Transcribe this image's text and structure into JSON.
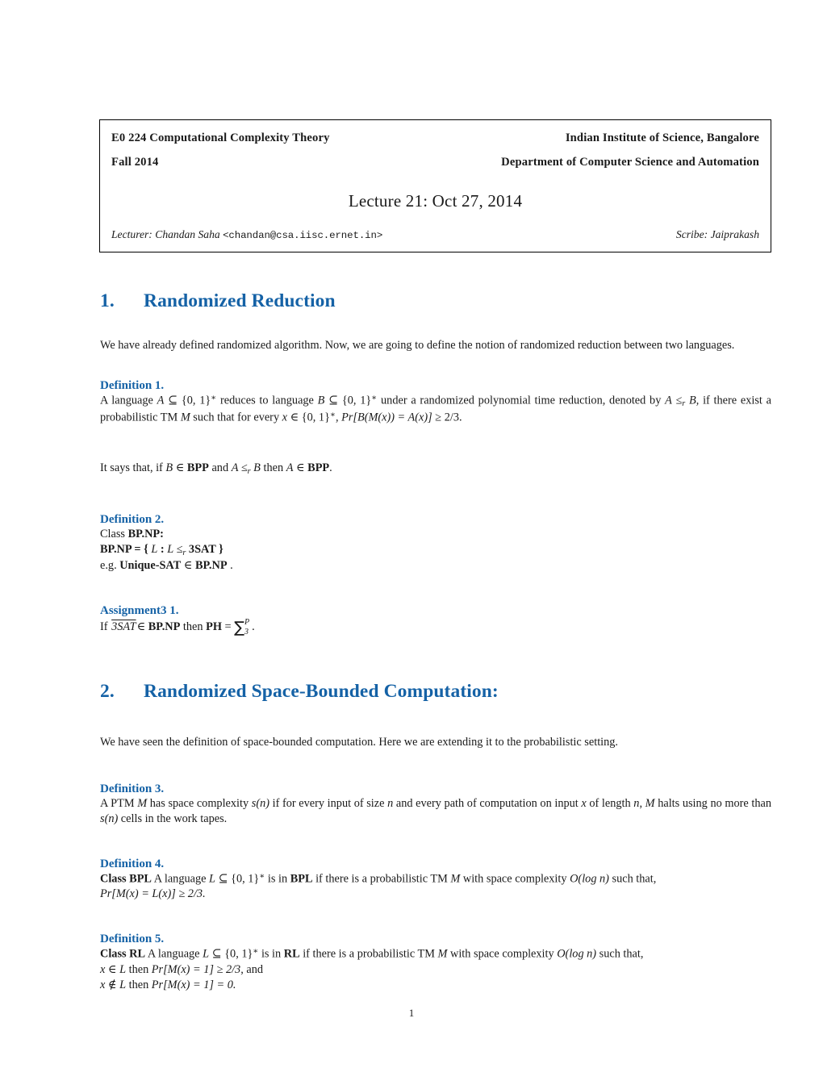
{
  "header": {
    "course": "E0 224 Computational Complexity Theory",
    "institute": "Indian Institute of Science, Bangalore",
    "term": "Fall 2014",
    "department": "Department of Computer Science and Automation",
    "lecture_title": "Lecture 21: Oct 27, 2014",
    "lecturer_label": "Lecturer:",
    "lecturer_name": "Chandan Saha",
    "lecturer_email": "<chandan@csa.iisc.ernet.in>",
    "scribe_label": "Scribe:",
    "scribe_name": "Jaiprakash"
  },
  "sections": {
    "s1": {
      "number": "1.",
      "title": "Randomized Reduction",
      "intro": "We have already defined randomized algorithm. Now, we are going to define the notion of randomized reduction between two languages.",
      "def1": {
        "heading": "Definition 1.",
        "line1_a": "A language ",
        "line1_A": "A",
        "line1_b": " ⊆ {0, 1}",
        "line1_star": "∗",
        "line1_c": " reduces to language ",
        "line1_B": "B",
        "line1_d": " ⊆ {0, 1}",
        "line1_e": " under a randomized polynomial time reduction, denoted by ",
        "line1_f": "A ≤",
        "line1_r": "r",
        "line1_g": " B",
        "line1_h": ", if there exist a probabilistic TM ",
        "line1_M": "M",
        "line1_i": " such that for every ",
        "line1_x": "x",
        "line1_j": " ∈ {0, 1}",
        "line1_k": ", ",
        "line1_pr": "Pr[B(M(x)) = A(x)]",
        "line1_l": " ≥ 2/3."
      },
      "remark": {
        "a": "It says that, if ",
        "B": "B",
        "b": " ∈ ",
        "bpp1": "BPP",
        "c": " and ",
        "d": "A ≤",
        "r": "r",
        "e": " B",
        "f": " then ",
        "A": "A",
        "g": " ∈ ",
        "bpp2": "BPP",
        "h": "."
      },
      "def2": {
        "heading": "Definition 2.",
        "line1_a": "Class ",
        "line1_b": "BP.NP:",
        "line2_a": "BP.NP",
        "line2_b": " = { ",
        "line2_L1": "L",
        "line2_c": " : ",
        "line2_L2": "L",
        "line2_d": " ≤",
        "line2_r": "r",
        "line2_e": " ",
        "line2_f": "3SAT",
        "line2_g": " }",
        "line3_a": "e.g. ",
        "line3_b": "Unique-SAT",
        "line3_c": " ∈ ",
        "line3_d": "BP.NP",
        "line3_e": " ."
      },
      "assignment": {
        "heading": "Assignment3 1.",
        "a": "If ",
        "overline": "3SAT",
        "b": "∈ ",
        "bpnp": "BP.NP",
        "c": " then ",
        "ph": "PH",
        "d": " = ",
        "sum_symbol": "∑",
        "sum_sub": "3",
        "sum_sup": "P",
        "e": "."
      }
    },
    "s2": {
      "number": "2.",
      "title": "Randomized Space-Bounded Computation:",
      "intro": "We have seen the definition of space-bounded computation. Here we are extending it to the probabilistic setting.",
      "def3": {
        "heading": "Definition 3.",
        "a": "A PTM ",
        "M1": "M",
        "b": " has space complexity ",
        "s1": "s(n)",
        "c": " if for every input of size ",
        "n1": "n",
        "d": " and every path of computation on input ",
        "x": "x",
        "e": " of length ",
        "n2": "n",
        "f": ", ",
        "M2": "M",
        "g": " halts using no more than ",
        "s2": "s(n)",
        "h": " cells in the work tapes."
      },
      "def4": {
        "heading": "Definition 4.",
        "a": "Class ",
        "bpl1": "BPL",
        "b": " A language ",
        "L": "L",
        "c": " ⊆ {0, 1}",
        "star": "∗",
        "d": " is in ",
        "bpl2": "BPL",
        "e": " if there is a probabilistic TM ",
        "M": "M",
        "f": " with space complexity ",
        "O": "O(log n)",
        "g": " such that,",
        "line2": "Pr[M(x) = L(x)] ≥ 2/3."
      },
      "def5": {
        "heading": "Definition 5.",
        "a": "Class ",
        "rl1": "RL",
        "b": " A language ",
        "L": "L",
        "c": " ⊆ {0, 1}",
        "star": "∗",
        "d": " is in ",
        "rl2": "RL",
        "e": " if there is a probabilistic TM ",
        "M": "M",
        "f": " with space complexity ",
        "O": "O(log n)",
        "g": " such that,",
        "line2": "x ∈ L",
        "line2b": " then ",
        "line2c": "Pr[M(x) = 1] ≥ 2/3",
        "line2d": ", and",
        "line3": "x ∉ L",
        "line3b": " then ",
        "line3c": "Pr[M(x) = 1] = 0."
      }
    }
  },
  "footer": {
    "page_number": "1"
  },
  "colors": {
    "heading_blue": "#1562a6",
    "text_black": "#1a1a1a",
    "page_background": "#ffffff"
  }
}
